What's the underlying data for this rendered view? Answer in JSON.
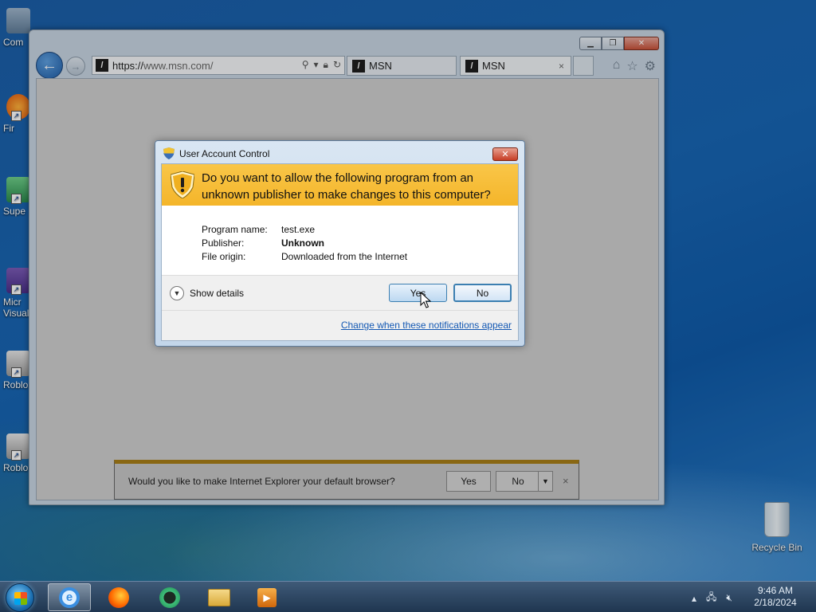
{
  "desktop": {
    "icons": [
      {
        "label": "Com"
      },
      {
        "label": "Fir"
      },
      {
        "label": "Supe"
      },
      {
        "label": "Micr Visual"
      },
      {
        "label": "Roblo"
      },
      {
        "label": "Roblo"
      }
    ],
    "recycle_bin": "Recycle Bin"
  },
  "browser": {
    "address": {
      "scheme": "https://",
      "domain": "www.msn.com/"
    },
    "tabs": [
      {
        "label": "MSN"
      },
      {
        "label": "MSN",
        "close": "×"
      }
    ],
    "notification": {
      "text": "Would you like to make Internet Explorer your default browser?",
      "yes": "Yes",
      "no": "No",
      "close": "×"
    }
  },
  "uac": {
    "title": "User Account Control",
    "question": "Do you want to allow the following program from an unknown publisher to make changes to this computer?",
    "details": [
      {
        "key": "Program name:",
        "value": "test.exe",
        "bold": false
      },
      {
        "key": "Publisher:",
        "value": "Unknown",
        "bold": true
      },
      {
        "key": "File origin:",
        "value": "Downloaded from the Internet",
        "bold": false
      }
    ],
    "show_details": "Show details",
    "yes": "Yes",
    "no": "No",
    "change_link": "Change when these notifications appear"
  },
  "taskbar": {
    "time": "9:46 AM",
    "date": "2/18/2024"
  },
  "colors": {
    "uac_header": "#f4b52a",
    "link": "#1358b3",
    "desktop": "#1866b4"
  }
}
